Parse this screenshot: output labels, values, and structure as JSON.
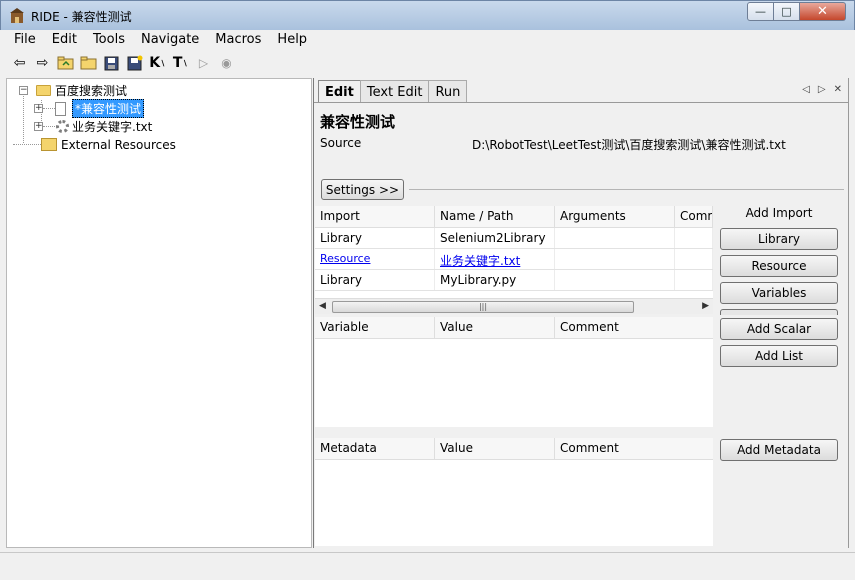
{
  "window": {
    "title": "RIDE - 兼容性测试"
  },
  "menu": [
    "File",
    "Edit",
    "Tools",
    "Navigate",
    "Macros",
    "Help"
  ],
  "toolbar": {
    "icons": [
      "back-arrow-icon",
      "forward-arrow-icon",
      "open-directory-icon",
      "open-folder-icon",
      "save-icon",
      "save-all-icon",
      "keyword-search-icon",
      "test-search-icon",
      "run-icon",
      "stop-icon"
    ]
  },
  "tree": {
    "root": "百度搜索测试",
    "items": [
      "*兼容性测试",
      "业务关键字.txt"
    ],
    "external": "External Resources"
  },
  "tabs": [
    "Edit",
    "Text Edit",
    "Run"
  ],
  "editor": {
    "suite_name": "兼容性测试",
    "source_label": "Source",
    "source_path": "D:\\RobotTest\\LeetTest测试\\百度搜索测试\\兼容性测试.txt",
    "settings_button": "Settings >>",
    "import_table": {
      "headers": [
        "Import",
        "Name / Path",
        "Arguments",
        "Comm"
      ],
      "rows": [
        [
          "Library",
          "Selenium2Library",
          "",
          ""
        ],
        [
          "Resource",
          "业务关键字.txt",
          "",
          ""
        ],
        [
          "Library",
          "MyLibrary.py",
          "",
          ""
        ]
      ]
    },
    "add_import_label": "Add Import",
    "import_buttons": [
      "Library",
      "Resource",
      "Variables"
    ],
    "variable_table": {
      "headers": [
        "Variable",
        "Value",
        "Comment"
      ]
    },
    "variable_buttons": [
      "Add Scalar",
      "Add List"
    ],
    "metadata_table": {
      "headers": [
        "Metadata",
        "Value",
        "Comment"
      ]
    },
    "metadata_button": "Add Metadata"
  },
  "colors": {
    "selection": "#3399ff",
    "link": "#0000ee"
  }
}
